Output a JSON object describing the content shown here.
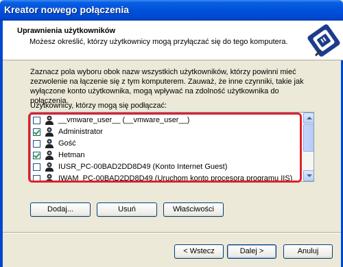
{
  "window": {
    "title": "Kreator nowego połączenia"
  },
  "header": {
    "title": "Uprawnienia użytkowników",
    "subtitle": "Możesz określić, którzy użytkownicy mogą przyłączać się do tego komputera."
  },
  "intro": {
    "line1": "Zaznacz pola wyboru obok nazw wszystkich użytkowników, którzy powinni mieć",
    "line2": "zezwolenie na łączenie się z tym komputerem. Zauważ, że inne czynniki, takie jak",
    "line3": "wyłączone konto użytkownika, mogą wpływać na zdolność użytkownika do połączenia."
  },
  "users_label": "Użytkownicy, którzy mogą się podłączać:",
  "users": [
    {
      "name": "__vmware_user__ (__vmware_user__)",
      "checked": false
    },
    {
      "name": "Administrator",
      "checked": true
    },
    {
      "name": "Gość",
      "checked": false
    },
    {
      "name": "Hetman",
      "checked": true
    },
    {
      "name": "IUSR_PC-00BAD2DD8D49 (Konto Internet Guest)",
      "checked": false
    },
    {
      "name": "IWAM_PC-00BAD2DD8D49 (Uruchom konto procesora programu IIS)",
      "checked": false
    }
  ],
  "buttons": {
    "add": "Dodaj...",
    "remove": "Usuń",
    "properties": "Właściwości",
    "back": "< Wstecz",
    "next": "Dalej >",
    "cancel": "Anuluj"
  },
  "colors": {
    "titlebar": "#0050DD",
    "highlight": "#E0202C",
    "face": "#ECE9D8"
  },
  "icons": {
    "header": "network-connection-icon",
    "user": "user-icon"
  }
}
